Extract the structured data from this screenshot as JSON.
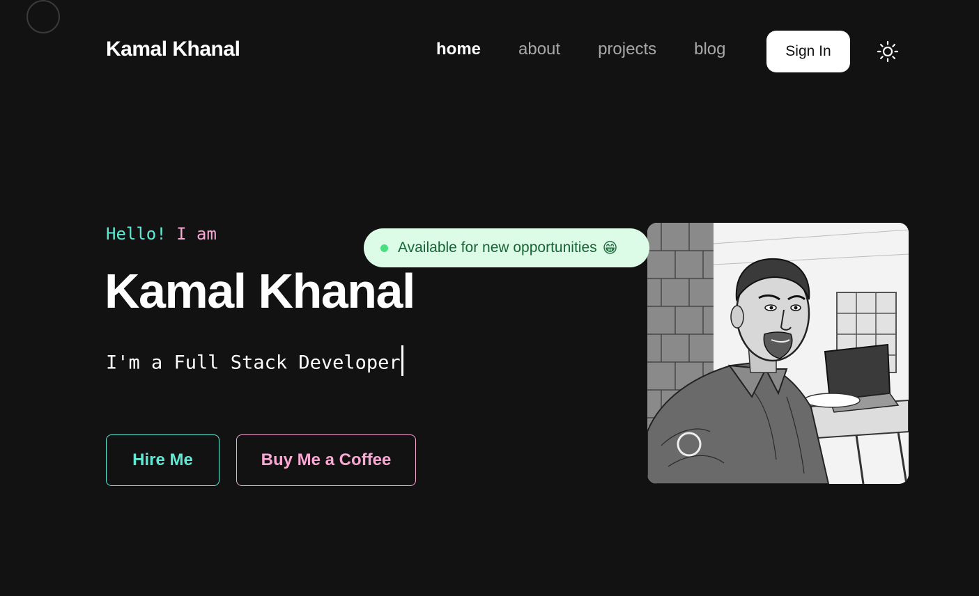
{
  "header": {
    "brand": "Kamal Khanal",
    "nav": [
      {
        "label": "home",
        "active": true
      },
      {
        "label": "about",
        "active": false
      },
      {
        "label": "projects",
        "active": false
      },
      {
        "label": "blog",
        "active": false
      }
    ],
    "signin_label": "Sign In",
    "theme_icon": "sun-icon"
  },
  "hero": {
    "greeting_part1": "Hello!",
    "greeting_part2": "I am",
    "name": "Kamal Khanal",
    "role": "I'm a Full Stack Developer",
    "hire_label": "Hire Me",
    "coffee_label": "Buy Me a Coffee",
    "availability": "Available for new opportunities",
    "availability_emoji": "😁",
    "profile_image": "sketch portrait photo"
  },
  "colors": {
    "background": "#121212",
    "accent_teal": "#5eead4",
    "accent_pink": "#f9a8d4",
    "badge_bg": "#dcfce7",
    "badge_text": "#166534",
    "badge_dot": "#4ade80"
  }
}
